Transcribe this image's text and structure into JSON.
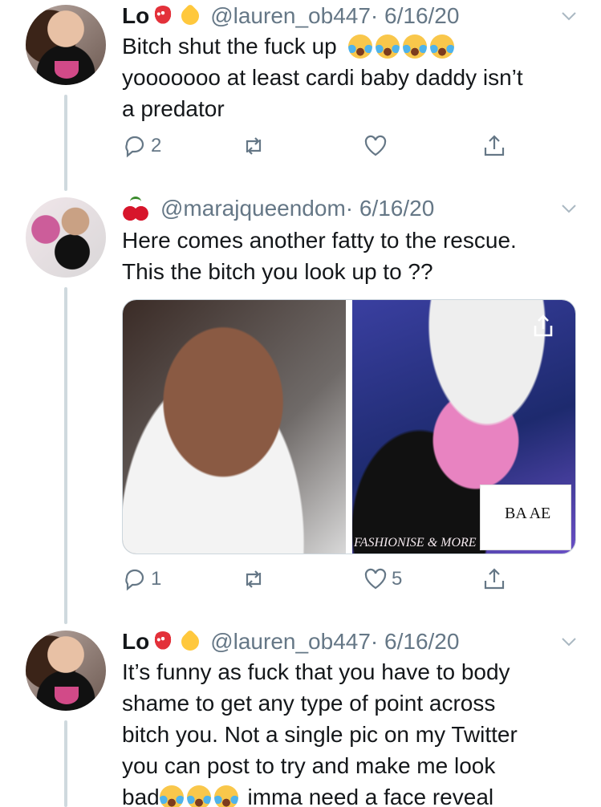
{
  "tweets": [
    {
      "name": "Lo",
      "handle": "@lauren_ob447",
      "date": "· 6/16/20",
      "line1": "Bitch shut the fuck up",
      "line2": "yooooooo at least cardi baby daddy isn’t",
      "line3": "a predator",
      "replies": "2",
      "retweets": "",
      "likes": "",
      "emojis": [
        "mushroom-emoji",
        "yellow-heart-emoji",
        "face-with-tears-of-joy-emoji"
      ]
    },
    {
      "handle": "@marajqueendom",
      "date": "· 6/16/20",
      "line1": "Here comes another fatty to the rescue.",
      "line2": "This the bitch you look up to ??",
      "media_watermark": "FASHIONISE & MORE",
      "media_logo": "BA AE",
      "replies": "1",
      "retweets": "",
      "likes": "5",
      "emojis": [
        "cherries-emoji"
      ]
    },
    {
      "name": "Lo",
      "handle": "@lauren_ob447",
      "date": "· 6/16/20",
      "line1": "It’s funny as fuck that you have to body",
      "line2": "shame to get any type of point across",
      "line3": "bitch you. Not a single pic on my Twitter",
      "line4": "you can post to try and make me look",
      "line5a": "bad",
      "line5b": "imma need a face reveal",
      "emojis": [
        "mushroom-emoji",
        "yellow-heart-emoji",
        "face-with-tears-of-joy-emoji"
      ]
    }
  ],
  "colors": {
    "text": "#14171a",
    "secondary": "#657786",
    "thread_line": "#cfd9de"
  }
}
